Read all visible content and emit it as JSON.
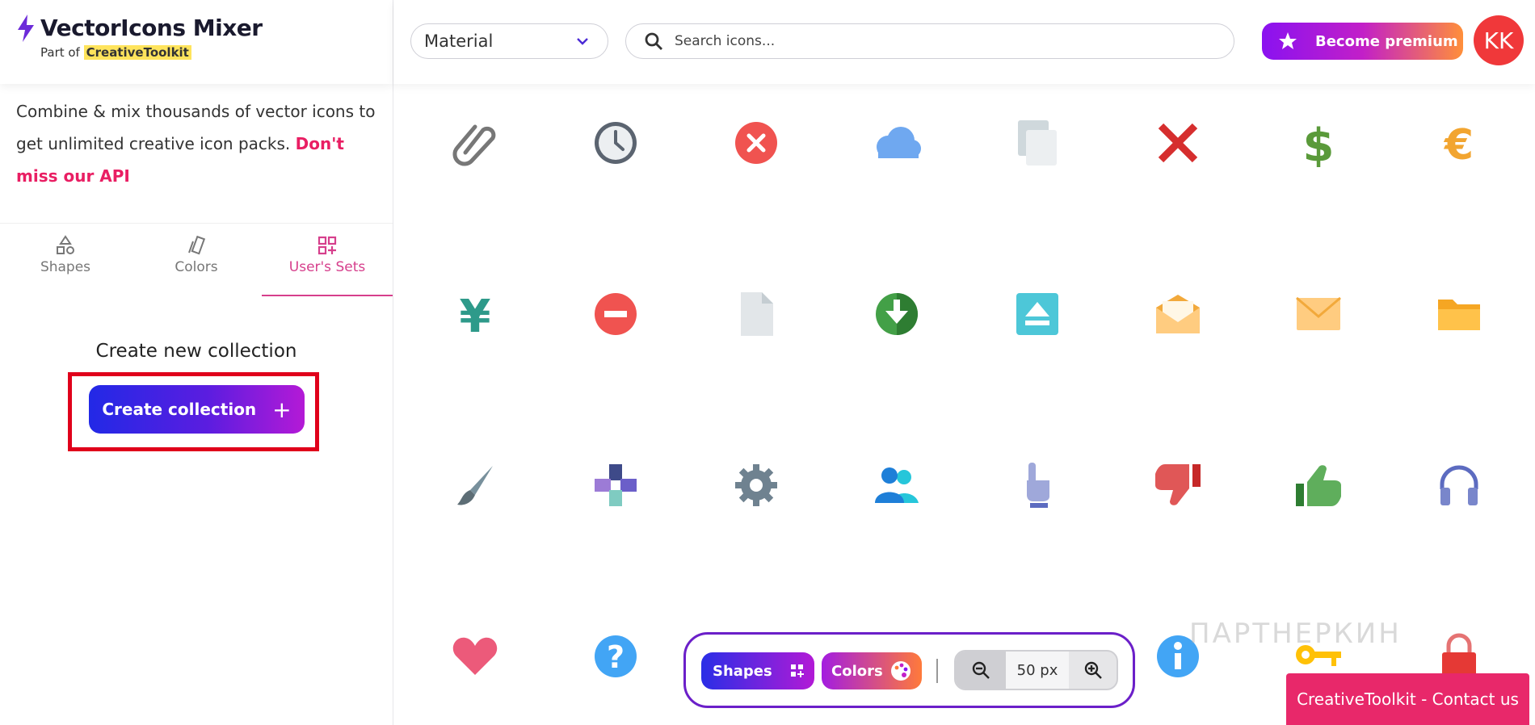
{
  "brand": {
    "title": "VectorIcons Mixer",
    "sub_prefix": "Part of ",
    "sub_highlight": "CreativeToolkit"
  },
  "intro": {
    "text": "Combine & mix thousands of vector icons to get unlimited creative icon packs. ",
    "link": "Don't miss our API"
  },
  "tabs": [
    {
      "label": "Shapes",
      "active": false
    },
    {
      "label": "Colors",
      "active": false
    },
    {
      "label": "User's Sets",
      "active": true
    }
  ],
  "collection": {
    "heading": "Create new collection",
    "button_label": "Create collection",
    "button_plus": "+"
  },
  "topbar": {
    "select_value": "Material",
    "search_placeholder": "Search icons...",
    "premium_label": "Become premium",
    "avatar_initials": "KK"
  },
  "icons": [
    "paperclip-icon",
    "clock-icon",
    "error-circle-icon",
    "cloud-icon",
    "copy-icon",
    "close-x-icon",
    "dollar-icon",
    "euro-icon",
    "yen-icon",
    "no-entry-icon",
    "document-icon",
    "download-circle-icon",
    "eject-icon",
    "open-envelope-icon",
    "envelope-icon",
    "folder-icon",
    "brush-icon",
    "cross-puzzle-icon",
    "gear-icon",
    "users-icon",
    "pointing-hand-icon",
    "thumbs-down-icon",
    "thumbs-up-icon",
    "headphones-icon",
    "heart-icon",
    "question-icon",
    "",
    "",
    "",
    "info-icon",
    "key-icon",
    "lock-icon"
  ],
  "toolbar": {
    "shapes_label": "Shapes",
    "colors_label": "Colors",
    "zoom_value": "50 px"
  },
  "watermark": "ПАРТНЕРКИН",
  "contact_label": "CreativeToolkit - Contact us",
  "colors": {
    "accent_pink": "#e91e63",
    "active_tab": "#d63f8c",
    "highlight_red": "#e0001b",
    "avatar": "#f0383a"
  }
}
